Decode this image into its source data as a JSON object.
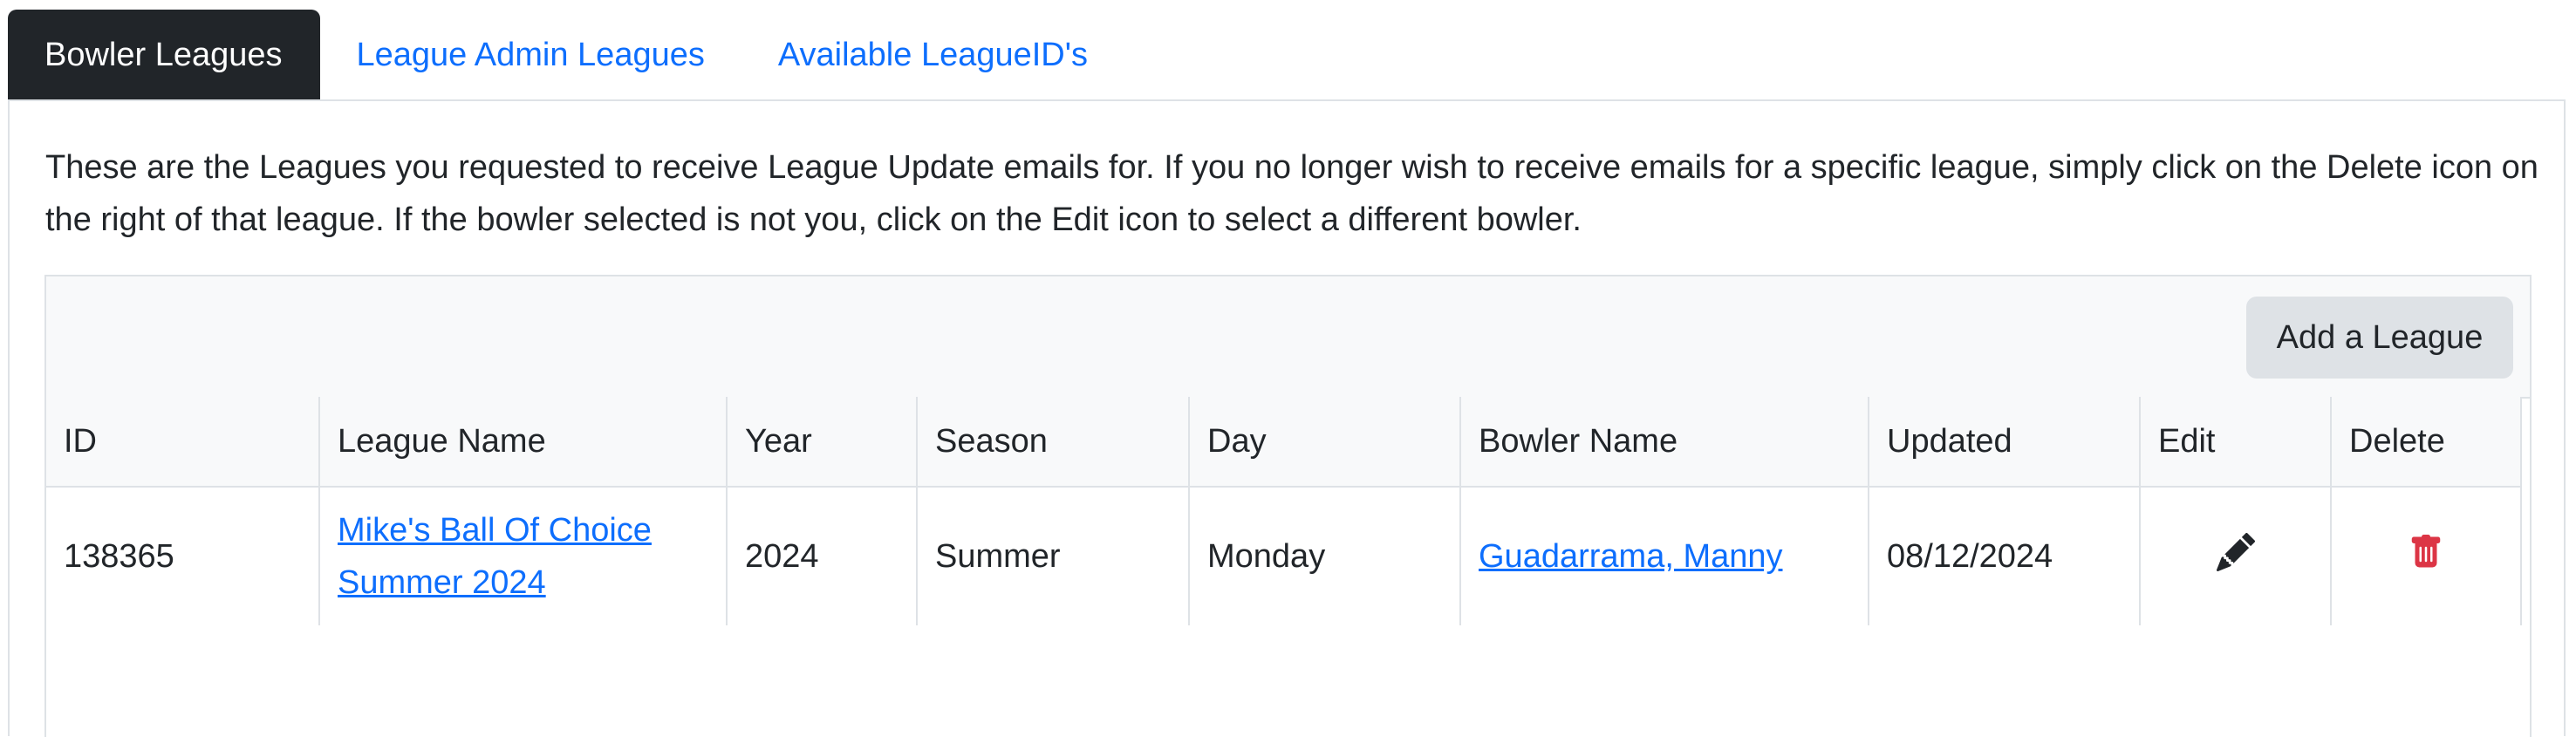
{
  "tabs": [
    {
      "label": "Bowler Leagues",
      "active": true
    },
    {
      "label": "League Admin Leagues",
      "active": false
    },
    {
      "label": "Available LeagueID's",
      "active": false
    }
  ],
  "intro_text": "These are the Leagues you requested to receive League Update emails for. If you no longer wish to receive emails for a specific league, simply click on the Delete icon on the right of that league. If the bowler selected is not you, click on the Edit icon to select a different bowler.",
  "toolbar": {
    "add_label": "Add a League"
  },
  "table": {
    "headers": [
      "ID",
      "League Name",
      "Year",
      "Season",
      "Day",
      "Bowler Name",
      "Updated",
      "Edit",
      "Delete"
    ],
    "rows": [
      {
        "id": "138365",
        "league_name": "Mike's Ball Of Choice Summer 2024",
        "year": "2024",
        "season": "Summer",
        "day": "Monday",
        "bowler_name": "Guadarrama, Manny",
        "updated": "08/12/2024",
        "edit_icon": "pencil-icon",
        "delete_icon": "trash-icon"
      }
    ]
  },
  "colors": {
    "link": "#0d6efd",
    "active_tab_bg": "#212529",
    "delete": "#dc3545",
    "toolbar_bg": "#f8f9fa",
    "button_bg": "#dee2e6"
  }
}
